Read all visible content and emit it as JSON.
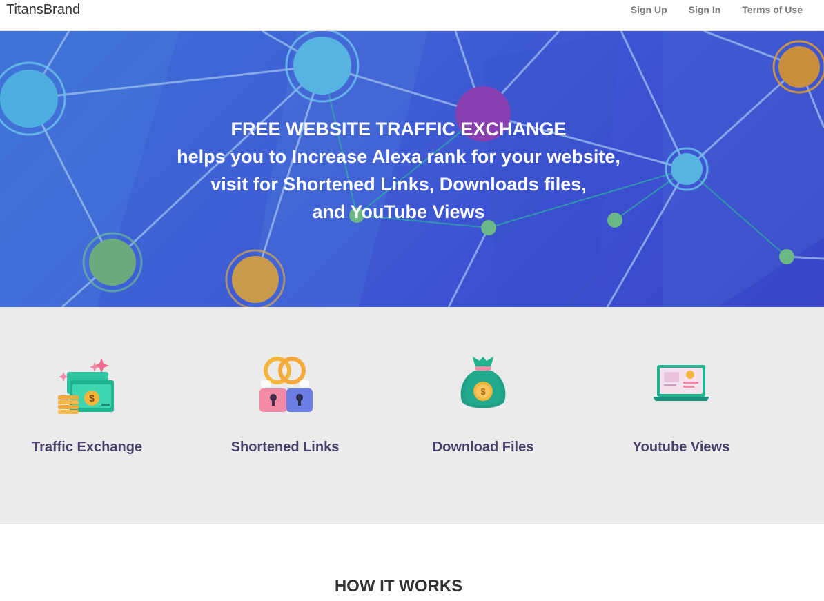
{
  "navbar": {
    "brand": "TitansBrand",
    "links": [
      {
        "label": "Sign Up"
      },
      {
        "label": "Sign In"
      },
      {
        "label": "Terms of Use"
      }
    ]
  },
  "hero": {
    "lines": [
      "FREE WEBSITE TRAFFIC EXCHANGE",
      "helps you to Increase Alexa rank for your website,",
      "visit for Shortened Links, Downloads files,",
      "and YouTube Views"
    ]
  },
  "features": [
    {
      "label": "Traffic Exchange",
      "icon": "money-stack-icon"
    },
    {
      "label": "Shortened Links",
      "icon": "locked-links-icon"
    },
    {
      "label": "Download Files",
      "icon": "money-bag-icon"
    },
    {
      "label": "Youtube Views",
      "icon": "laptop-icon"
    }
  ],
  "how_it_works": {
    "title": "HOW IT WORKS"
  },
  "colors": {
    "hero_bg": "#3f5ed4",
    "feature_label": "#4a3f6b",
    "features_bg": "#ebebeb"
  }
}
